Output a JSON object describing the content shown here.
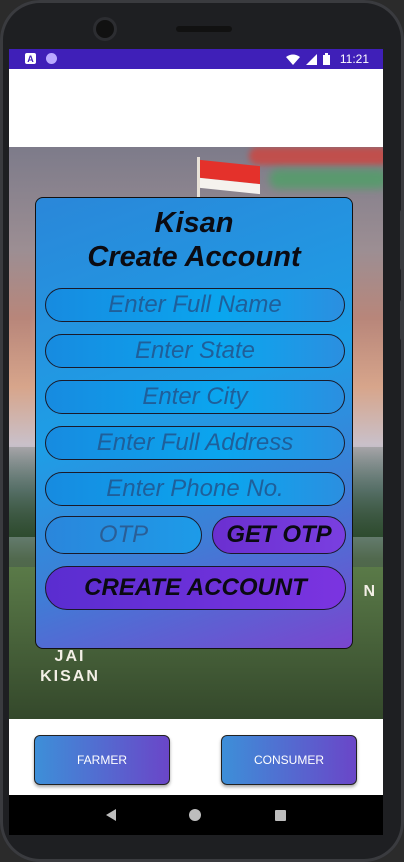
{
  "status_bar": {
    "time": "11:21",
    "left_icons": [
      "a-notification-icon",
      "circle-notification-icon"
    ],
    "right_icons": [
      "wifi-icon",
      "signal-icon",
      "battery-icon"
    ],
    "a_icon_text": "A"
  },
  "hero": {
    "slogan_line1": "JAI",
    "slogan_line2": "KISAN",
    "slogan_side": "N"
  },
  "form": {
    "title_line1": "Kisan",
    "title_line2": "Create Account",
    "full_name_placeholder": "Enter Full Name",
    "state_placeholder": "Enter State",
    "city_placeholder": "Enter City",
    "address_placeholder": "Enter Full Address",
    "phone_placeholder": "Enter Phone No.",
    "otp_placeholder": "OTP",
    "get_otp_label": "GET OTP",
    "create_account_label": "CREATE ACCOUNT"
  },
  "roles": {
    "farmer_label": "FARMER",
    "consumer_label": "CONSUMER"
  },
  "colors": {
    "status_bar": "#3f1fb8",
    "card_gradient_start": "#2a87d9",
    "card_gradient_end": "#7a45cf",
    "button_purple": "#6b2fd0"
  }
}
